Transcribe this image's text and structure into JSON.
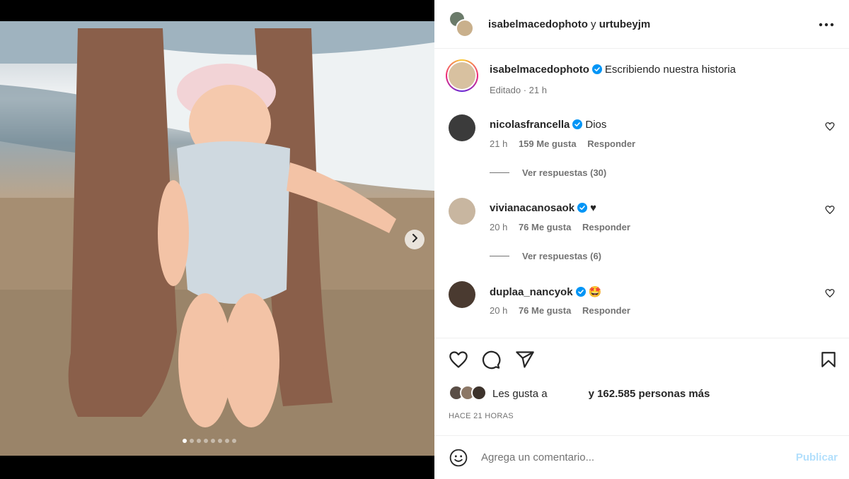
{
  "header": {
    "author": "isabelmacedophoto",
    "connector": " y ",
    "coauthor": "urtubeyjm"
  },
  "caption": {
    "username": "isabelmacedophoto",
    "text": "Escribiendo nuestra historia",
    "edited": "Editado · 21 h"
  },
  "comments": [
    {
      "username": "nicolasfrancella",
      "text": "Dios",
      "time": "21 h",
      "likes": "159 Me gusta",
      "reply": "Responder",
      "replies": "Ver respuestas (30)",
      "avatar_color": "#3b3b3b"
    },
    {
      "username": "vivianacanosaok",
      "text": "♥",
      "time": "20 h",
      "likes": "76 Me gusta",
      "reply": "Responder",
      "replies": "Ver respuestas (6)",
      "avatar_color": "#c8b6a0"
    },
    {
      "username": "duplaa_nancyok",
      "text": "🤩",
      "time": "20 h",
      "likes": "76 Me gusta",
      "reply": "Responder",
      "avatar_color": "#4a3a30"
    }
  ],
  "likes": {
    "prefix": "Les gusta a",
    "suffix": "y 162.585 personas más"
  },
  "time_ago": "HACE 21 HORAS",
  "comment_box": {
    "placeholder": "Agrega un comentario...",
    "post_label": "Publicar"
  },
  "carousel": {
    "slides": 8,
    "active": 1
  },
  "colors": {
    "verified": "#0095f6",
    "post_button": "#b2dffc",
    "meta": "#737373"
  },
  "icons": [
    "more-icon",
    "verified-icon",
    "heart-icon",
    "comment-icon",
    "share-icon",
    "bookmark-icon",
    "emoji-icon",
    "chevron-right-icon"
  ]
}
